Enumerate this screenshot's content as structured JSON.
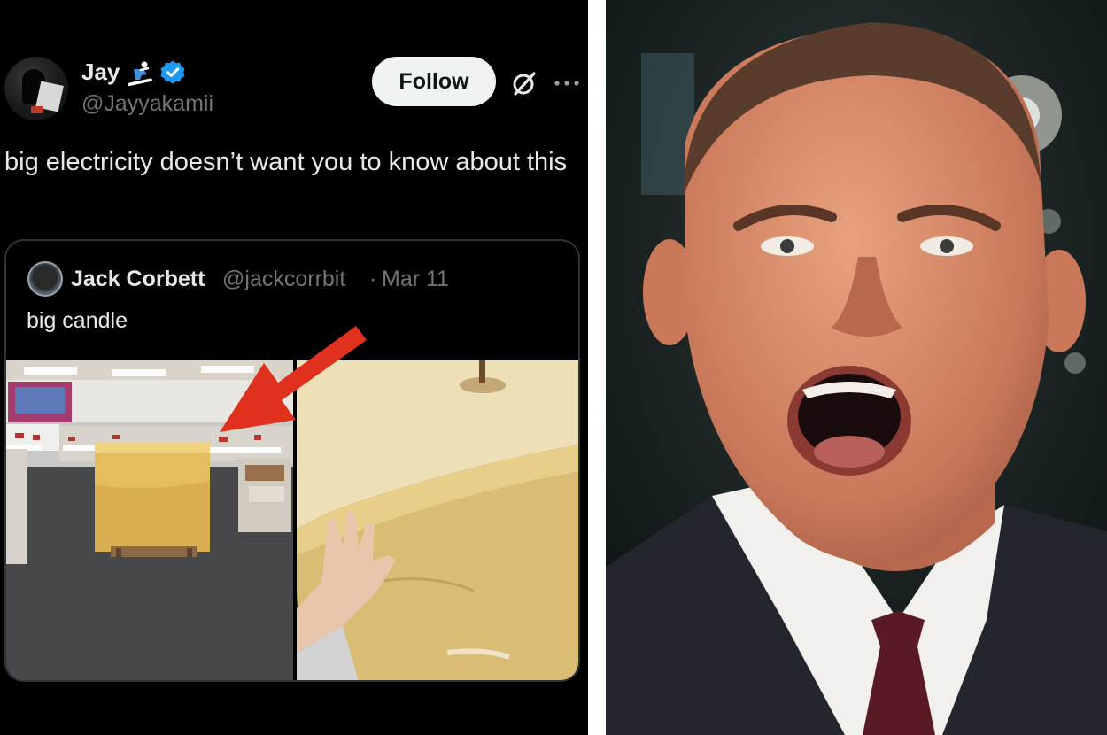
{
  "tweet": {
    "author": {
      "name": "Jay",
      "handle": "@Jayyakamii",
      "verified": true,
      "name_emoji": "skier-icon"
    },
    "follow_label": "Follow",
    "text": "big electricity doesn’t want you to know about this",
    "quoted": {
      "name": "Jack Corbett",
      "handle": "@jackcorrbit",
      "separator": "·",
      "date": "Mar 11",
      "text": "big candle"
    }
  },
  "colors": {
    "background": "#000000",
    "text_primary": "#e7e9ea",
    "text_secondary": "#71767b",
    "verified_blue": "#1d9bf0",
    "follow_bg": "#eff3f4",
    "arrow_red": "#e0301e"
  },
  "icons": [
    "skier-icon",
    "verified-badge-icon",
    "grok-icon",
    "more-options-icon",
    "red-arrow-icon"
  ]
}
